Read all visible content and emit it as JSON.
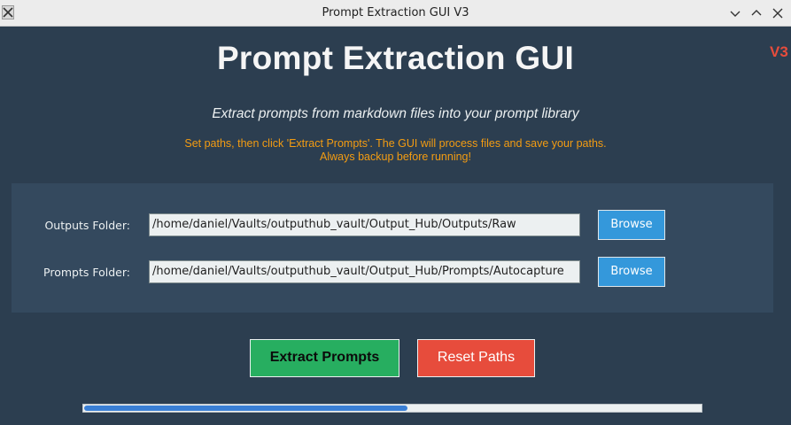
{
  "window": {
    "title": "Prompt Extraction GUI V3",
    "icon": "x-app-icon"
  },
  "header": {
    "title": "Prompt Extraction GUI",
    "version": "V3",
    "subtitle": "Extract prompts from markdown files into your prompt library",
    "instructions_line1": "Set paths, then click 'Extract Prompts'. The GUI will process files and save your paths.",
    "instructions_line2": "Always backup before running!"
  },
  "paths": {
    "outputs": {
      "label": "Outputs Folder:",
      "value": "/home/daniel/Vaults/outputhub_vault/Output_Hub/Outputs/Raw",
      "button": "Browse"
    },
    "prompts": {
      "label": "Prompts Folder:",
      "value": "/home/daniel/Vaults/outputhub_vault/Output_Hub/Prompts/Autocapture",
      "button": "Browse"
    }
  },
  "actions": {
    "extract_label": "Extract Prompts",
    "reset_label": "Reset Paths"
  },
  "progress": {
    "fraction": 0.525
  },
  "colors": {
    "background": "#2c3e50",
    "panel": "#34495e",
    "version": "#e74c3c",
    "instructions": "#f39c12",
    "browse": "#3498db",
    "extract": "#27ae60",
    "reset": "#e74c3c",
    "progress": "#3a7fd5"
  }
}
